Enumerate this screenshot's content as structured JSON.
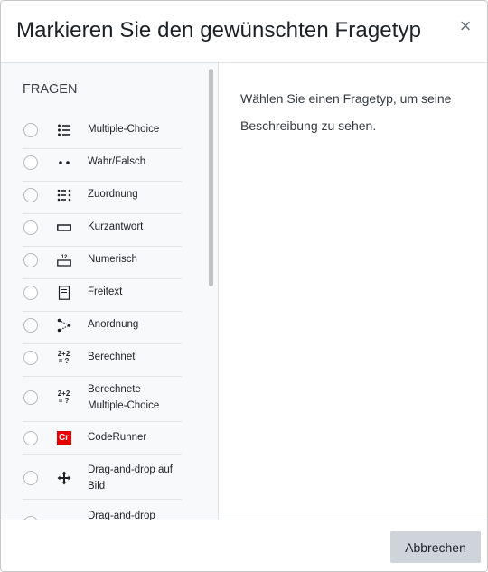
{
  "dialog": {
    "title": "Markieren Sie den gewünschten Fragetyp",
    "close_symbol": "×"
  },
  "left": {
    "heading": "FRAGEN",
    "options": [
      {
        "label": "Multiple-Choice",
        "icon": "list-icon"
      },
      {
        "label": "Wahr/Falsch",
        "icon": "two-dots-icon"
      },
      {
        "label": "Zuordnung",
        "icon": "match-list-icon"
      },
      {
        "label": "Kurzantwort",
        "icon": "short-answer-icon"
      },
      {
        "label": "Numerisch",
        "icon": "numeric-icon"
      },
      {
        "label": "Freitext",
        "icon": "essay-icon"
      },
      {
        "label": "Anordnung",
        "icon": "ordering-icon"
      },
      {
        "label": "Berechnet",
        "icon": "calculated-icon",
        "icon_text": [
          "2+2",
          "= ?"
        ]
      },
      {
        "label": "Berechnete Multiple-Choice",
        "icon": "calculated-multichoice-icon",
        "icon_text": [
          "2+2",
          "= ?"
        ]
      },
      {
        "label": "CodeRunner",
        "icon": "coderunner-icon",
        "icon_text": [
          "Cr"
        ]
      },
      {
        "label": "Drag-and-drop auf Bild",
        "icon": "move-arrows-icon"
      },
      {
        "label": "Drag-and-drop",
        "icon": "drag-drop-icon"
      }
    ]
  },
  "right": {
    "description": "Wählen Sie einen Fragetyp, um seine Beschreibung zu sehen."
  },
  "footer": {
    "cancel_label": "Abbrechen"
  },
  "colors": {
    "left_background": "#f8f9fa",
    "cancel_button": "#ced4da",
    "coderunner_red": "#e60000"
  }
}
